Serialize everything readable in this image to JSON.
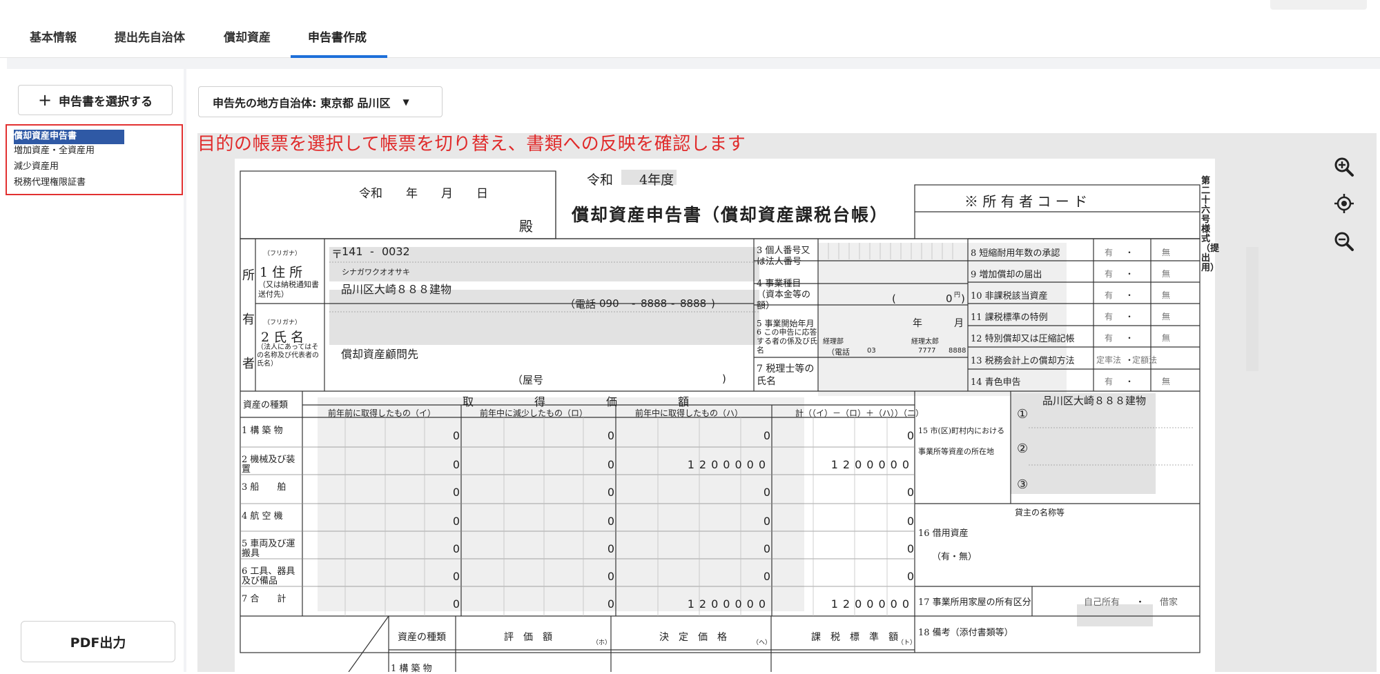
{
  "tabs": [
    "基本情報",
    "提出先自治体",
    "償却資産",
    "申告書作成"
  ],
  "sidebar": {
    "select_button": "申告書を選択する",
    "documents": [
      "償却資産申告書",
      "増加資産・全資産用",
      "減少資産用",
      "税務代理権限証書"
    ],
    "pdf_button": "PDF出力"
  },
  "toolbar": {
    "municipality": "申告先の地方自治体: 東京都 品川区"
  },
  "annotation": "目的の帳票を選択して帳票を切り替え、書類への反映を確認します",
  "icons": {
    "zoom_in": "zoom-in-icon",
    "recenter": "crosshair-icon",
    "zoom_out": "zoom-out-icon",
    "plus": "plus-icon",
    "caret": "caret-down-icon"
  },
  "form": {
    "date_label": "令和　　年　　月　　日",
    "addressee": "殿",
    "year": "令和　　4年度",
    "title": "償却資産申告書（償却資産課税台帳）",
    "owner_code": "※ 所 有 者 コ ー ド",
    "side_label": "第二十六号様式（提出用）",
    "owner_block": "所　有　者",
    "postal_prefix": "〒",
    "postal1": "141",
    "postal2": "0032",
    "address_label": "1 住 所",
    "address_sub": "（又は納税通知書送付先）",
    "furigana_label": "（フリガナ）",
    "address_kana": "シナガワクオオサキ",
    "address": "品川区大崎８８８建物",
    "phone_label": "（電話",
    "phone1": "090",
    "phone2": "8888",
    "phone3": "8888",
    "name_label": "2 氏 名",
    "name_sub": "（法人にあってはその名称及び代表者の氏名）",
    "name": "償却資産顧問先",
    "trade_name": "（屋号",
    "item3": "3 個人番号又は法人番号",
    "item4": "4 事業種目（資本金等の額）",
    "capital": "0",
    "yen": "円",
    "item5": "5 事業開始年月",
    "year_unit": "年",
    "month_unit": "月",
    "item6": "6 この申告に応答する者の係及び氏名",
    "contact_dept": "経理部",
    "contact_name": "経理太郎",
    "contact_phone_label": "（電話",
    "contact_phone1": "03",
    "contact_phone2": "7777",
    "contact_phone3": "8888",
    "item7": "7 税理士等の氏名",
    "checks": [
      {
        "label": "8 短縮耐用年数の承認",
        "opt1": "有",
        "opt2": "無"
      },
      {
        "label": "9 増加償却の届出",
        "opt1": "有",
        "opt2": "無"
      },
      {
        "label": "10 非課税該当資産",
        "opt1": "有",
        "opt2": "無"
      },
      {
        "label": "11 課税標準の特例",
        "opt1": "有",
        "opt2": "無"
      },
      {
        "label": "12 特別償却又は圧縮記帳",
        "opt1": "有",
        "opt2": "無"
      },
      {
        "label": "13 税務会計上の償却方法",
        "opt1": "定率法",
        "opt2": "定額法"
      },
      {
        "label": "14 青色申告",
        "opt1": "有",
        "opt2": "無"
      }
    ],
    "acq_header": "取　　　得　　　価　　　額",
    "asset_type": "資産の種類",
    "col_i": "前年前に取得したもの（イ）",
    "col_ro": "前年中に減少したもの（ロ）",
    "col_ha": "前年中に取得したもの（ハ）",
    "col_ni": "計（（イ）－（ロ）＋（ハ））（ニ）",
    "rows": [
      {
        "label": "1 構 築 物",
        "i": "0",
        "ro": "0",
        "ha": "0",
        "ni": "0"
      },
      {
        "label": "2 機械及び装置",
        "i": "0",
        "ro": "0",
        "ha": "1200000",
        "ni": "1200000"
      },
      {
        "label": "3 船　　舶",
        "i": "0",
        "ro": "0",
        "ha": "0",
        "ni": "0"
      },
      {
        "label": "4 航 空 機",
        "i": "0",
        "ro": "0",
        "ha": "0",
        "ni": "0"
      },
      {
        "label": "5 車両及び運搬具",
        "i": "0",
        "ro": "0",
        "ha": "0",
        "ni": "0"
      },
      {
        "label": "6 工具、器具及び備品",
        "i": "0",
        "ro": "0",
        "ha": "0",
        "ni": "0"
      },
      {
        "label": "7 合　　計",
        "i": "0",
        "ro": "0",
        "ha": "1200000",
        "ni": "1200000"
      }
    ],
    "item15": "15 市(区)町村内における事業所等資産の所在地",
    "location1_mark": "①",
    "location1": "品川区大崎８８８建物",
    "location2_mark": "②",
    "location3_mark": "③",
    "item16": "16 借用資産",
    "item16_opts": "（有・無）",
    "lessor": "貸主の名称等",
    "item17": "17 事業所用家屋の所有区分",
    "own_opt1": "自己所有",
    "own_opt2": "借家",
    "item18": "18 備考（添付書類等）",
    "lower_asset_type": "資産の種類",
    "valuation": "評　価　額",
    "valuation_mark": "（ホ）",
    "decided": "決　定　価　格",
    "decided_mark": "（ヘ）",
    "tax_base": "課　税　標　準　額",
    "tax_base_mark": "（ト）",
    "lower_row1": "1 構 築 物"
  }
}
